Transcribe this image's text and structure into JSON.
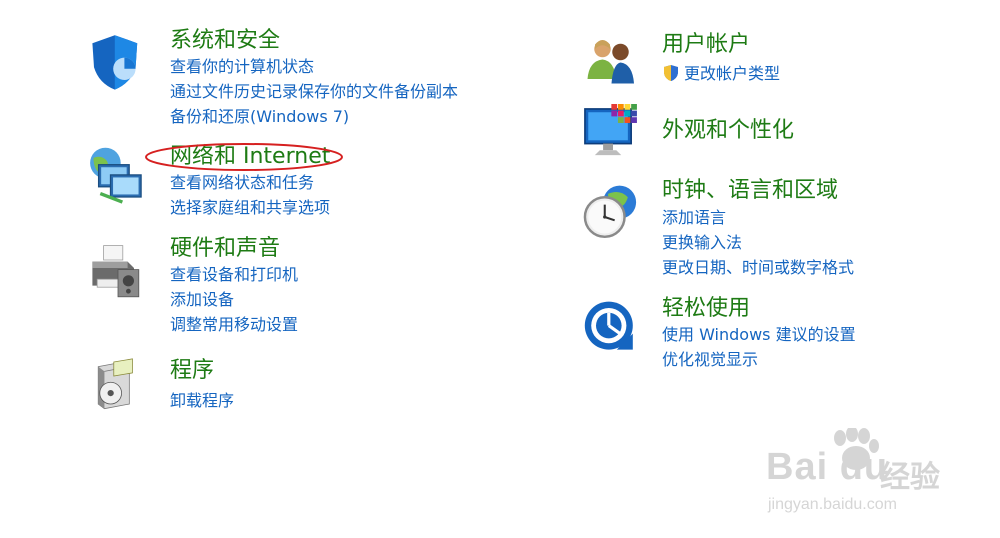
{
  "categories": {
    "security": {
      "title": "系统和安全",
      "links": [
        "查看你的计算机状态",
        "通过文件历史记录保存你的文件备份副本",
        "备份和还原(Windows 7)"
      ]
    },
    "network": {
      "title": "网络和 Internet",
      "links": [
        "查看网络状态和任务",
        "选择家庭组和共享选项"
      ]
    },
    "hardware": {
      "title": "硬件和声音",
      "links": [
        "查看设备和打印机",
        "添加设备",
        "调整常用移动设置"
      ]
    },
    "programs": {
      "title": "程序",
      "links": [
        "卸载程序"
      ]
    },
    "users": {
      "title": "用户帐户",
      "links": [
        "更改帐户类型"
      ]
    },
    "appearance": {
      "title": "外观和个性化",
      "links": []
    },
    "clock": {
      "title": "时钟、语言和区域",
      "links": [
        "添加语言",
        "更换输入法",
        "更改日期、时间或数字格式"
      ]
    },
    "ease": {
      "title": "轻松使用",
      "links": [
        "使用 Windows 建议的设置",
        "优化视觉显示"
      ]
    }
  },
  "watermark": {
    "brand": "Bai du",
    "cn": "经验",
    "url": "jingyan.baidu.com"
  },
  "colors": {
    "title_green": "#1e7b14",
    "link_blue": "#1565c0",
    "annotation_red": "#d62020"
  },
  "icons": {
    "security": "shield-icon",
    "network": "network-globe-icon",
    "hardware": "printer-icon",
    "programs": "program-box-icon",
    "users": "users-icon",
    "appearance": "monitor-colors-icon",
    "clock": "clock-globe-icon",
    "ease": "ease-of-access-icon"
  }
}
